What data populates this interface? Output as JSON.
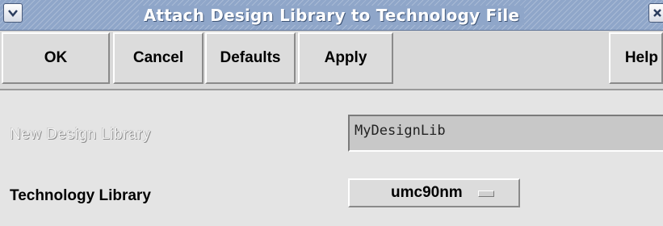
{
  "window": {
    "title": "Attach Design Library to Technology File"
  },
  "toolbar": {
    "ok_label": "OK",
    "cancel_label": "Cancel",
    "defaults_label": "Defaults",
    "apply_label": "Apply",
    "help_label": "Help"
  },
  "form": {
    "design_library": {
      "label": "New Design Library",
      "value": "MyDesignLib",
      "disabled": true
    },
    "technology_library": {
      "label": "Technology Library",
      "selected": "umc90nm"
    }
  },
  "icons": {
    "window_menu": "chevron-down-icon",
    "window_close": "close-icon"
  },
  "colors": {
    "titlebar": "#8fa6c9",
    "dialog_background": "#e4e4e4",
    "field_background": "#c8c8c8"
  }
}
